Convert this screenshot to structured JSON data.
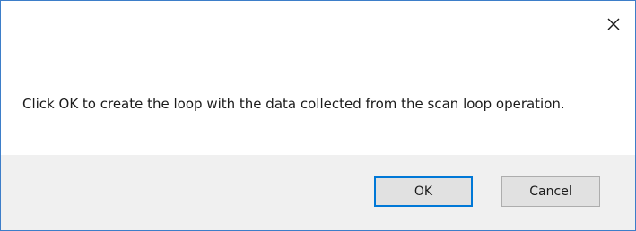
{
  "dialog": {
    "message": "Click OK to create the loop with the data collected from the scan loop operation.",
    "close_icon": "close-icon",
    "buttons": {
      "ok_label": "OK",
      "cancel_label": "Cancel"
    },
    "colors": {
      "border": "#3d7ec9",
      "footer_bg": "#f0f0f0",
      "default_button_border": "#0078d7"
    }
  }
}
